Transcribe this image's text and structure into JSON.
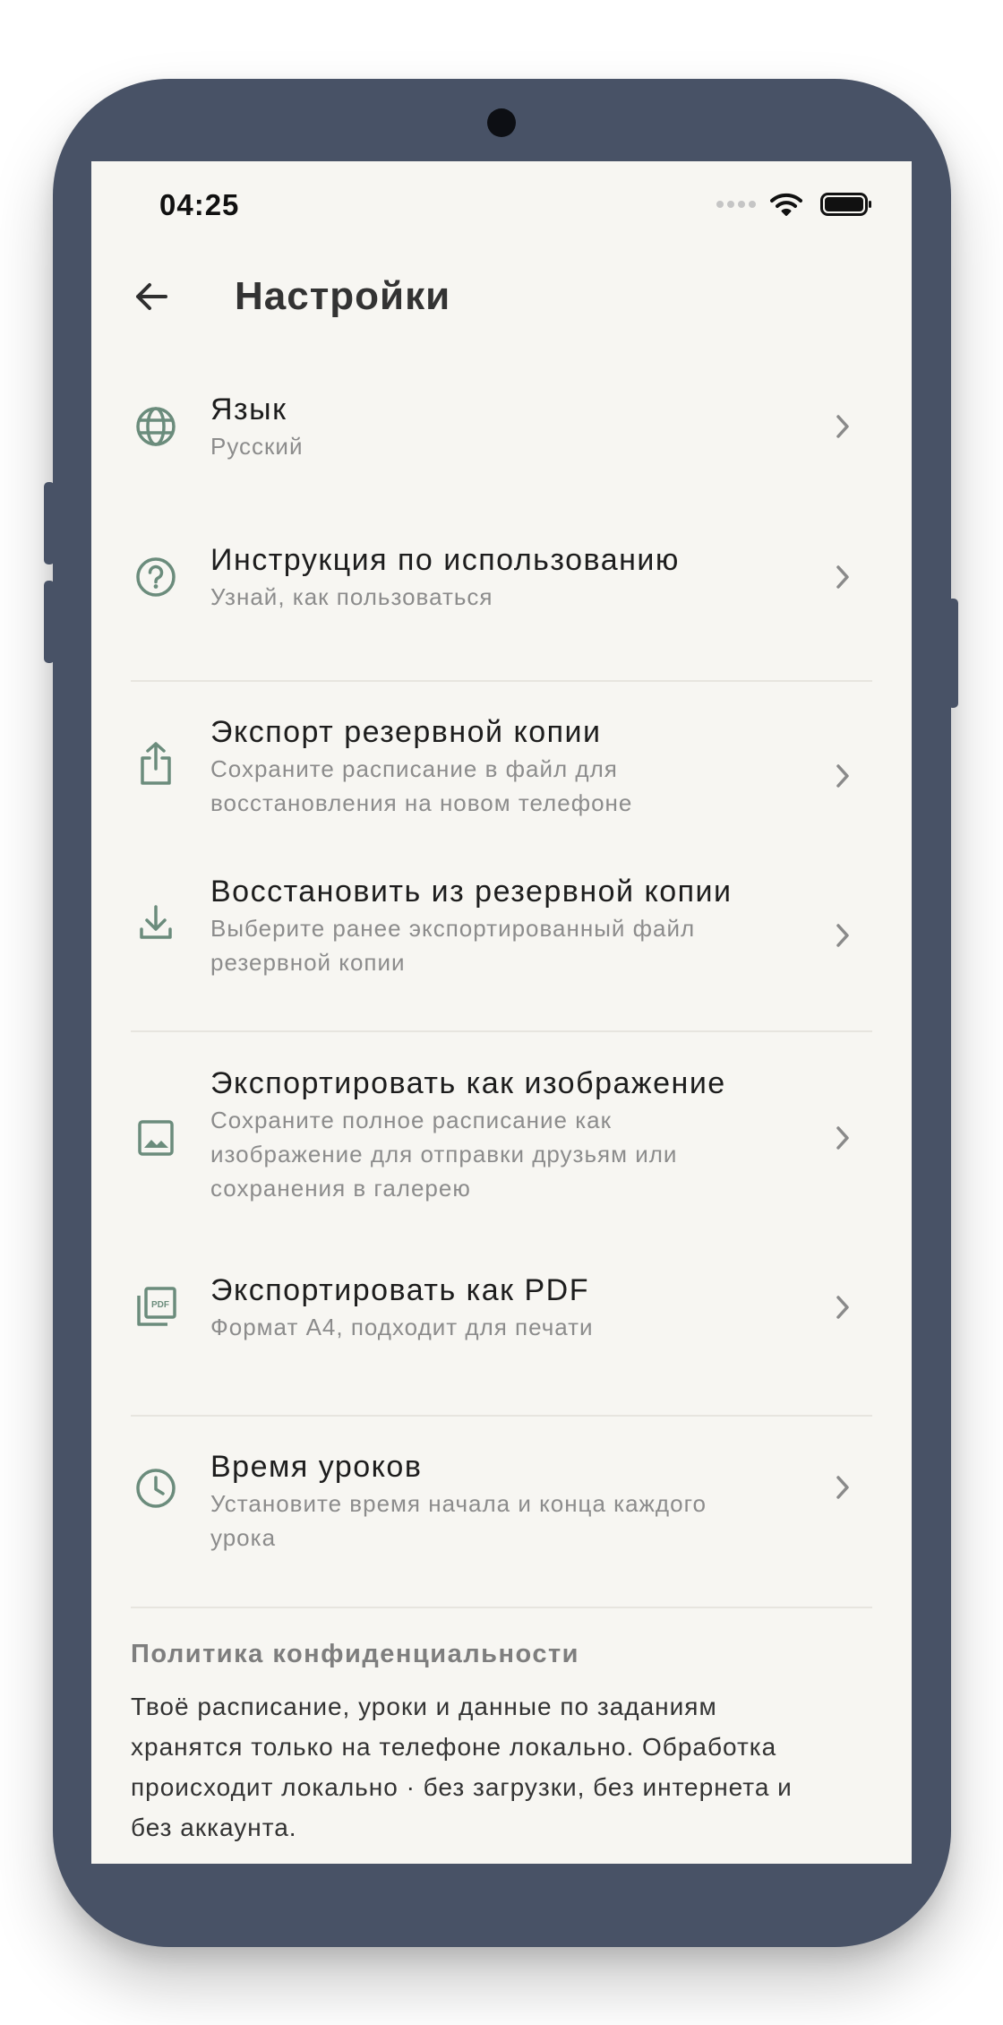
{
  "status_bar": {
    "time": "04:25",
    "icons": [
      "signal-dots-icon",
      "wifi-icon",
      "battery-icon"
    ]
  },
  "header": {
    "back_icon": "arrow-left-icon",
    "title": "Настройки"
  },
  "colors": {
    "accent": "#6b8c7c",
    "background": "#f7f6f2",
    "frame": "#485266",
    "subtitle": "#8c8c8c"
  },
  "settings": {
    "language": {
      "icon": "globe-icon",
      "title": "Язык",
      "subtitle": "Русский"
    },
    "instructions": {
      "icon": "help-circle-icon",
      "title": "Инструкция по использованию",
      "subtitle": "Узнай, как пользоваться"
    },
    "backup_export": {
      "icon": "share-upload-icon",
      "title": "Экспорт резервной копии",
      "subtitle_line1": "Сохраните расписание в файл для",
      "subtitle_line2": "восстановления на новом телефоне"
    },
    "backup_restore": {
      "icon": "download-icon",
      "title": "Восстановить из резервной копии",
      "subtitle_line1": "Выберите ранее экспортированный файл",
      "subtitle_line2": "резервной копии"
    },
    "export_image": {
      "icon": "image-icon",
      "title": "Экспортировать как изображение",
      "subtitle_line1": "Сохраните полное расписание как",
      "subtitle_line2": "изображение для отправки друзьям или",
      "subtitle_line3": "сохранения в галерею"
    },
    "export_pdf": {
      "icon": "pdf-file-icon",
      "title": "Экспортировать как PDF",
      "subtitle": "Формат A4, подходит для печати"
    },
    "lesson_times": {
      "icon": "clock-icon",
      "title": "Время уроков",
      "subtitle_line1": "Установите время начала и конца каждого",
      "subtitle_line2": "урока"
    }
  },
  "privacy": {
    "title": "Политика конфиденциальности",
    "line1": "Твоё расписание, уроки и данные по заданиям",
    "line2": "хранятся только на телефоне локально. Обработка",
    "line3": "происходит локально · без загрузки, без интернета и",
    "line4": "без аккаунта."
  }
}
